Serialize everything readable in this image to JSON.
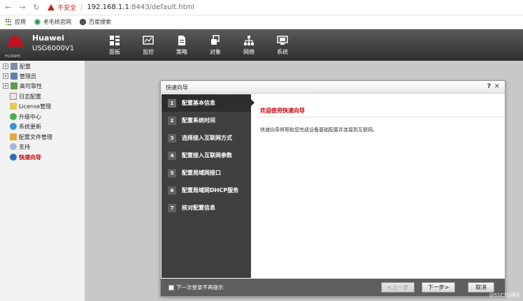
{
  "browser": {
    "security_label": "不安全",
    "url_host": "192.168.1.1",
    "url_rest": ":8443/default.html",
    "bookmarks": [
      {
        "label": "应用",
        "icon": "apps-grid-icon"
      },
      {
        "label": "老毛桃官网",
        "icon": "site-icon"
      },
      {
        "label": "百度搜索",
        "icon": "globe-icon"
      }
    ]
  },
  "header": {
    "logo_text": "HUAWEI",
    "brand": "Huawei",
    "model": "USG6000V1",
    "nav": [
      {
        "label": "面板",
        "icon": "dashboard-icon"
      },
      {
        "label": "监控",
        "icon": "monitor-icon"
      },
      {
        "label": "策略",
        "icon": "policy-icon"
      },
      {
        "label": "对象",
        "icon": "object-icon"
      },
      {
        "label": "网络",
        "icon": "network-icon"
      },
      {
        "label": "系统",
        "icon": "system-icon"
      }
    ]
  },
  "sidebar": {
    "items": [
      {
        "label": "配置",
        "expandable": true,
        "icon": "config-icon"
      },
      {
        "label": "管理员",
        "expandable": true,
        "icon": "admin-icon"
      },
      {
        "label": "高可靠性",
        "expandable": true,
        "icon": "ha-icon"
      },
      {
        "label": "日志配置",
        "expandable": false,
        "icon": "log-icon"
      },
      {
        "label": "License管理",
        "expandable": false,
        "icon": "license-icon"
      },
      {
        "label": "升级中心",
        "expandable": false,
        "icon": "upgrade-icon"
      },
      {
        "label": "系统更新",
        "expandable": false,
        "icon": "update-icon"
      },
      {
        "label": "配置文件管理",
        "expandable": false,
        "icon": "folder-icon"
      },
      {
        "label": "支持",
        "expandable": false,
        "icon": "support-icon"
      },
      {
        "label": "快速向导",
        "expandable": false,
        "icon": "wizard-icon",
        "active": true
      }
    ]
  },
  "dialog": {
    "title": "快速向导",
    "help": "?",
    "close": "×",
    "steps": [
      {
        "num": "1",
        "label": "配置基本信息"
      },
      {
        "num": "2",
        "label": "配置系统时间"
      },
      {
        "num": "3",
        "label": "选择接入互联网方式"
      },
      {
        "num": "4",
        "label": "配置接入互联网参数"
      },
      {
        "num": "5",
        "label": "配置局域网接口"
      },
      {
        "num": "6",
        "label": "配置局域网DHCP服务"
      },
      {
        "num": "7",
        "label": "核对配置信息"
      }
    ],
    "content_title": "欢迎使用快速向导",
    "content_desc": "快速向导将帮助您完成设备基础配置并连接到互联网。",
    "footer": {
      "checkbox_label": "下一次登录不再提示",
      "prev_label": "<上一步",
      "next_label": "下一步>",
      "cancel_label": "取消"
    }
  },
  "watermark": "@51CTO博客",
  "colors": {
    "accent_red": "#c7000b",
    "warning_red": "#c5221f",
    "step_panel": "#404040",
    "footer": "#5e5e5e"
  }
}
